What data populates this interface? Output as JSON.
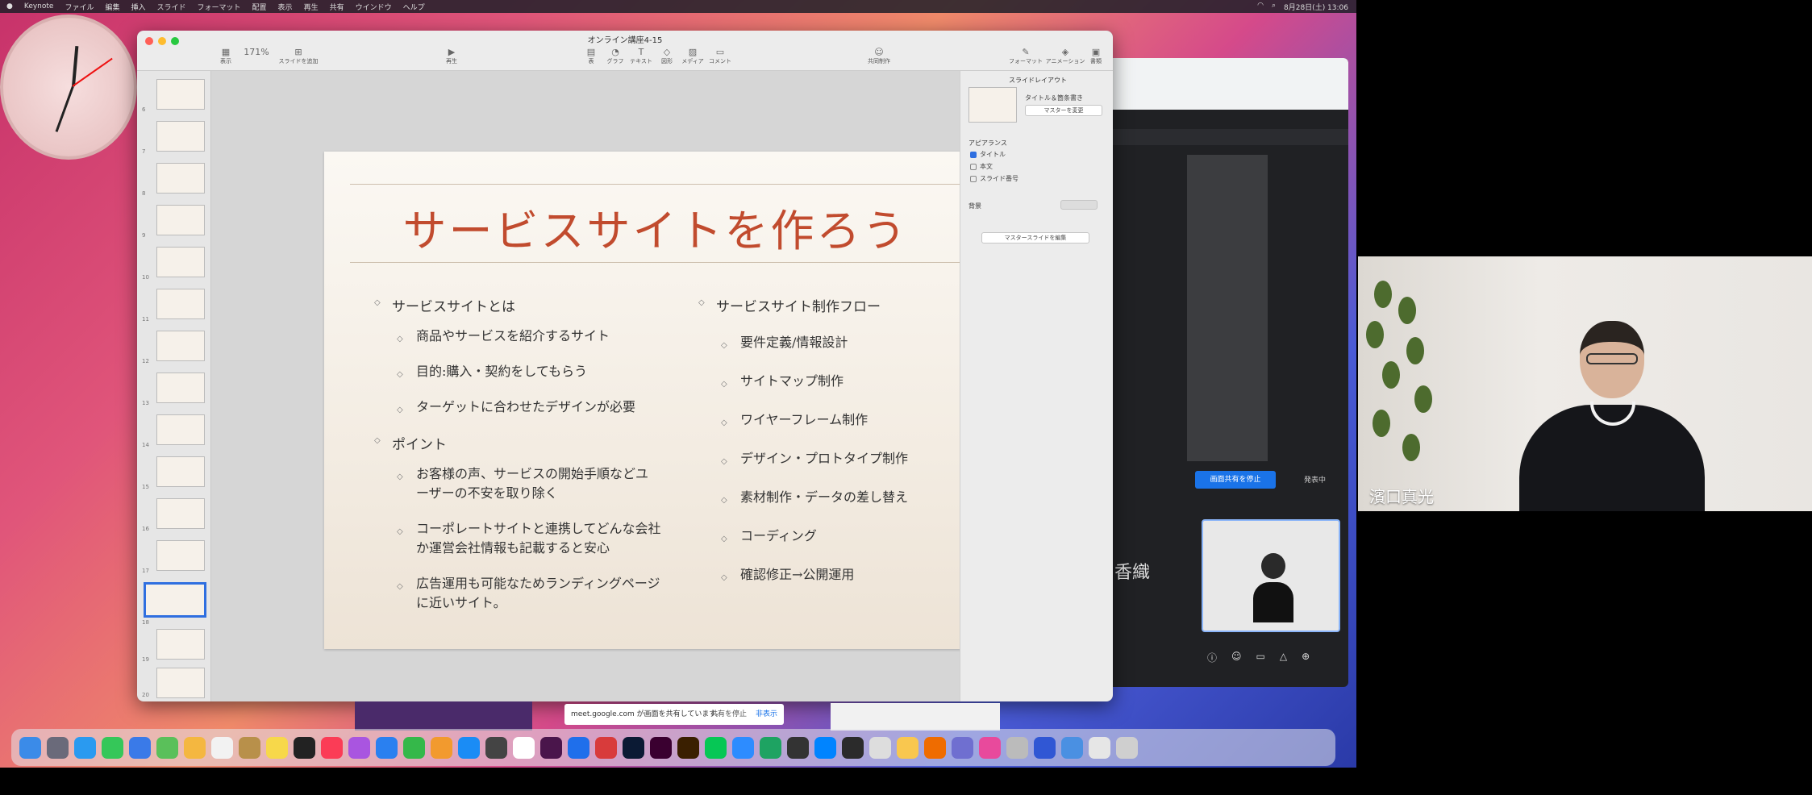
{
  "menubar": {
    "app": "Keynote",
    "items": [
      "ファイル",
      "編集",
      "挿入",
      "スライド",
      "フォーマット",
      "配置",
      "表示",
      "再生",
      "共有",
      "ウインドウ",
      "ヘルプ"
    ],
    "clock": "8月28日(土) 13:06"
  },
  "keynote": {
    "window_title": "オンライン講座4-15",
    "toolbar": {
      "view": "表示",
      "zoom": "171%",
      "add_slide": "スライドを追加",
      "play": "再生",
      "table": "表",
      "chart": "グラフ",
      "text": "テキスト",
      "shape": "図形",
      "media": "メディア",
      "comment": "コメント",
      "collaborate": "共同制作",
      "format": "フォーマット",
      "animate": "アニメーション",
      "document": "書類"
    },
    "slide_numbers": [
      "6",
      "7",
      "8",
      "9",
      "10",
      "11",
      "12",
      "13",
      "14",
      "15",
      "16",
      "17",
      "18",
      "19",
      "20"
    ],
    "slide": {
      "title": "サービスサイトを作ろう",
      "left": [
        {
          "level": 1,
          "text": "サービスサイトとは"
        },
        {
          "level": 2,
          "text": "商品やサービスを紹介するサイト"
        },
        {
          "level": 2,
          "text": "目的:購入・契約をしてもらう"
        },
        {
          "level": 2,
          "text": "ターゲットに合わせたデザインが必要"
        },
        {
          "level": 1,
          "text": "ポイント"
        },
        {
          "level": 2,
          "text": "お客様の声、サービスの開始手順などユーザーの不安を取り除く"
        },
        {
          "level": 2,
          "text": "コーポレートサイトと連携してどんな会社か運営会社情報も記載すると安心"
        },
        {
          "level": 2,
          "text": "広告運用も可能なためランディングページに近いサイト。"
        }
      ],
      "right": [
        {
          "level": 1,
          "text": "サービスサイト制作フロー"
        },
        {
          "level": 2,
          "text": "要件定義/情報設計"
        },
        {
          "level": 2,
          "text": "サイトマップ制作"
        },
        {
          "level": 2,
          "text": "ワイヤーフレーム制作"
        },
        {
          "level": 2,
          "text": "デザイン・プロトタイプ制作"
        },
        {
          "level": 2,
          "text": "素材制作・データの差し替え"
        },
        {
          "level": 2,
          "text": "コーディング"
        },
        {
          "level": 2,
          "text": "確認修正→公開運用"
        }
      ]
    },
    "inspector": {
      "header": "スライドレイアウト",
      "layout_name": "タイトル＆箇条書き",
      "change_master": "マスターを変更",
      "appearance": "アピアランス",
      "opt_title": "タイトル",
      "opt_body": "本文",
      "opt_number": "スライド番号",
      "background": "背景",
      "edit_master": "マスタースライドを編集"
    }
  },
  "meet": {
    "present_button": "画面共有を停止",
    "present_label": "発表中",
    "tile_name": "香織",
    "share_toast": "meet.google.com が画面を共有しています。",
    "stop_share": "共有を停止",
    "hide": "非表示"
  },
  "webcam": {
    "name": "濱口真光"
  },
  "colors": {
    "accent": "#c14b2e",
    "selection": "#2f6fe0",
    "meet_blue": "#1a73e8"
  }
}
